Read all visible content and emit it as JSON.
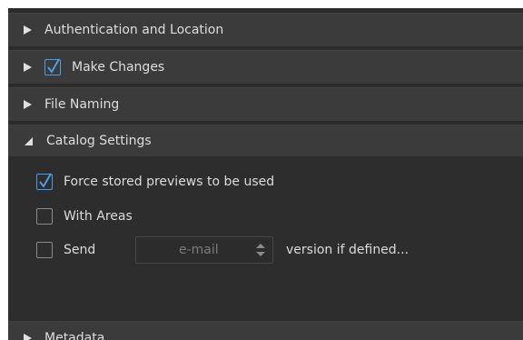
{
  "sections": {
    "auth": {
      "label": "Authentication and Location"
    },
    "make_changes": {
      "label": "Make Changes",
      "checked": true
    },
    "file_naming": {
      "label": "File Naming"
    },
    "catalog": {
      "label": "Catalog Settings",
      "expanded": true
    },
    "metadata": {
      "label": "Metadata"
    }
  },
  "catalog_options": {
    "force_previews": {
      "label": "Force stored previews to be used",
      "checked": true
    },
    "with_areas": {
      "label": "With Areas",
      "checked": false
    },
    "send": {
      "label": "Send",
      "checked": false,
      "select_value": "e-mail",
      "suffix": "version if defined..."
    }
  },
  "colors": {
    "accent": "#4aa0e6",
    "panel_bg": "#2c2c2c",
    "header_bg": "#3b3b3b",
    "text": "#dedede",
    "muted_text": "#7b7b7b"
  },
  "icons": {
    "collapsed": "triangle-right-icon",
    "expanded": "triangle-down-icon",
    "check": "checkmark-icon",
    "spinner": "up-down-arrows-icon"
  }
}
